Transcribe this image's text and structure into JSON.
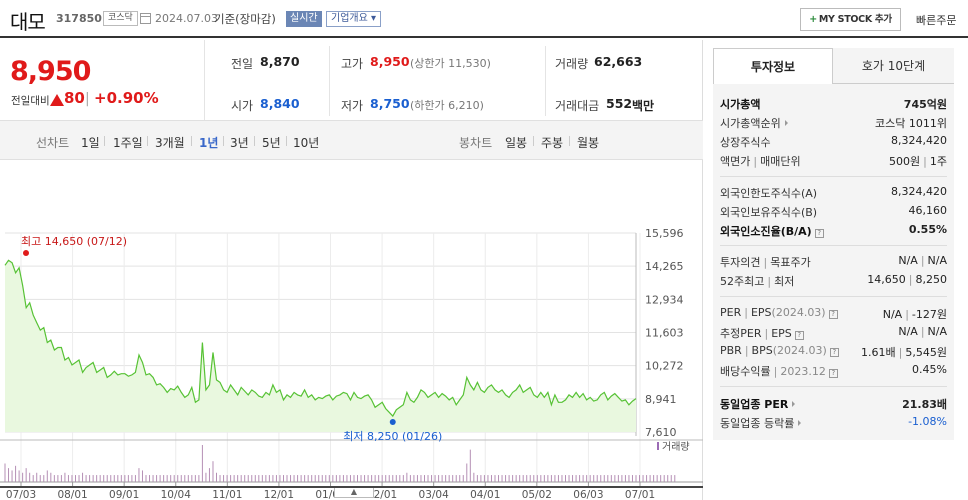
{
  "header": {
    "name": "대모",
    "code": "317850",
    "market": "코스닥",
    "date": "2024.07.03",
    "basis": "기준(장마감)",
    "realtime": "실시간",
    "overview": "기업개요 ▾",
    "mystock": "MY STOCK 추가",
    "mystock_plus": "+",
    "quick_order": "빠른주문"
  },
  "price": {
    "current": "8,950",
    "change_label": "전일대비",
    "change": "80",
    "pct": "+0.90%"
  },
  "quote": {
    "prev_label": "전일",
    "prev": "8,870",
    "high_label": "고가",
    "high": "8,950",
    "upper_limit": "(상한가 11,530)",
    "volume_label": "거래량",
    "volume": "62,663",
    "open_label": "시가",
    "open": "8,840",
    "low_label": "저가",
    "low": "8,750",
    "lower_limit": "(하한가 6,210)",
    "amount_label": "거래대금",
    "amount": "552",
    "amount_unit": "백만"
  },
  "periods": {
    "line_label": "선차트",
    "line": [
      "1일",
      "1주일",
      "3개월",
      "1년",
      "3년",
      "5년",
      "10년"
    ],
    "selected": "1년",
    "candle_label": "봉차트",
    "candle": [
      "일봉",
      "주봉",
      "월봉"
    ]
  },
  "right": {
    "tabs": [
      "투자정보",
      "호가 10단계"
    ],
    "market_cap_label": "시가총액",
    "market_cap": "745억원",
    "cap_rank_label": "시가총액순위",
    "cap_rank": "코스닥 1011위",
    "shares_label": "상장주식수",
    "shares": "8,324,420",
    "par_label": "액면가",
    "unit_label": "매매단위",
    "par": "500원",
    "unit": "1주",
    "foreign_limit_label": "외국인한도주식수(A)",
    "foreign_limit": "8,324,420",
    "foreign_hold_label": "외국인보유주식수(B)",
    "foreign_hold": "46,160",
    "foreign_rate_label": "외국인소진율(B/A)",
    "foreign_rate": "0.55%",
    "opinion_label": "투자의견",
    "target_label": "목표주가",
    "opinion": "N/A",
    "target": "N/A",
    "week52_label": "52주최고",
    "week52_low_label": "최저",
    "week52_high": "14,650",
    "week52_low": "8,250",
    "per_label": "PER",
    "eps_label": "EPS",
    "eps_period": "(2024.03)",
    "per": "N/A",
    "eps": "-127원",
    "est_per_label": "추정PER",
    "est_eps_label": "EPS",
    "est_per": "N/A",
    "est_eps": "N/A",
    "pbr_label": "PBR",
    "bps_label": "BPS",
    "bps_period": "(2024.03)",
    "pbr": "1.61배",
    "bps": "5,545원",
    "div_label": "배당수익률",
    "div_period": "2023.12",
    "div": "0.45%",
    "ind_per_label": "동일업종 PER",
    "ind_per": "21.83배",
    "ind_rate_label": "동일업종 등락률",
    "ind_rate": "-1.08%"
  },
  "colors": {
    "up": "#e01a1a",
    "down": "#1a5fd0",
    "line": "#57c235",
    "fill": "#e9f8df"
  },
  "chart_data": {
    "type": "area",
    "y_ticks": [
      "15,596",
      "14,265",
      "12,934",
      "11,603",
      "10,272",
      "8,941",
      "7,610"
    ],
    "ylim": [
      7610,
      15596
    ],
    "x_ticks": [
      "07/03",
      "08/01",
      "09/01",
      "10/04",
      "11/01",
      "12/01",
      "01/02",
      "02/01",
      "03/04",
      "04/01",
      "05/02",
      "06/03",
      "07/01"
    ],
    "max_label": "최고 14,650 (07/12)",
    "min_label": "최저 8,250 (01/26)",
    "volume_label": "거래량",
    "values": [
      14300,
      14500,
      14400,
      14000,
      14200,
      13500,
      12600,
      12800,
      12300,
      12000,
      11700,
      11800,
      11200,
      11300,
      10900,
      11000,
      11000,
      10500,
      10600,
      10300,
      10400,
      10500,
      10000,
      10200,
      10300,
      10400,
      10000,
      10100,
      10200,
      9800,
      9900,
      10050,
      9900,
      9950,
      9950,
      9850,
      9900,
      10000,
      10700,
      10400,
      9900,
      9950,
      9800,
      9500,
      9550,
      9400,
      9200,
      9350,
      9300,
      9450,
      9200,
      9000,
      9100,
      9400,
      8800,
      8900,
      11200,
      9300,
      9500,
      10800,
      9700,
      9600,
      9300,
      9200,
      9500,
      9300,
      9100,
      9400,
      9250,
      9100,
      9300,
      9200,
      9050,
      9000,
      9200,
      9100,
      9500,
      9200,
      9300,
      8900,
      9100,
      9000,
      9200,
      9100,
      9050,
      9300,
      9000,
      9100,
      8900,
      9000,
      8950,
      9050,
      9100,
      8900,
      9050,
      9100,
      9200,
      9150,
      8900,
      9200,
      9000,
      8950,
      9050,
      9100,
      8900,
      8600,
      8700,
      8800,
      8550,
      8400,
      8250,
      8500,
      8600,
      8700,
      9200,
      8900,
      8800,
      9000,
      9300,
      9200,
      9000,
      9100,
      9200,
      9000,
      9150,
      9050,
      8900,
      9000,
      8700,
      8900,
      9100,
      9800,
      9500,
      9300,
      9600,
      9300,
      9200,
      9400,
      9500,
      9300,
      9200,
      9300,
      9100,
      9000,
      9200,
      9300,
      9500,
      9200,
      9300,
      9400,
      9100,
      9000,
      9200,
      9000,
      9200,
      8700,
      9100,
      8800,
      8800,
      8900,
      9100,
      9000,
      9200,
      9000,
      9150,
      8900,
      9000,
      8850,
      8900,
      9100,
      9200,
      8900,
      9050,
      9150,
      9000,
      8850,
      8900,
      8700,
      8850,
      8950
    ],
    "volume": [
      8,
      6,
      5,
      7,
      5,
      4,
      6,
      4,
      3,
      4,
      3,
      3,
      5,
      4,
      3,
      3,
      3,
      4,
      3,
      3,
      3,
      3,
      4,
      3,
      3,
      3,
      3,
      3,
      3,
      3,
      3,
      3,
      3,
      3,
      3,
      3,
      3,
      3,
      6,
      5,
      3,
      3,
      3,
      3,
      3,
      3,
      3,
      3,
      3,
      3,
      3,
      3,
      3,
      3,
      3,
      3,
      16,
      4,
      6,
      9,
      4,
      3,
      3,
      3,
      3,
      3,
      3,
      3,
      3,
      3,
      3,
      3,
      3,
      3,
      3,
      3,
      3,
      3,
      3,
      3,
      3,
      3,
      3,
      3,
      3,
      3,
      3,
      3,
      3,
      3,
      3,
      3,
      3,
      3,
      3,
      3,
      3,
      3,
      3,
      3,
      3,
      3,
      3,
      3,
      3,
      3,
      3,
      3,
      3,
      3,
      3,
      3,
      3,
      3,
      4,
      3,
      3,
      3,
      3,
      3,
      3,
      3,
      3,
      3,
      3,
      3,
      3,
      3,
      3,
      3,
      3,
      8,
      14,
      4,
      3,
      3,
      3,
      3,
      3,
      3,
      3,
      3,
      3,
      3,
      3,
      3,
      3,
      3,
      3,
      3,
      3,
      3,
      3,
      3,
      3,
      3,
      3,
      3,
      3,
      3,
      3,
      3,
      3,
      3,
      3,
      3,
      3,
      3,
      3,
      3,
      3,
      3,
      3,
      3,
      3,
      3,
      3,
      3,
      3,
      3,
      3,
      3,
      3,
      3,
      3,
      3,
      3,
      3,
      3,
      3,
      3
    ]
  }
}
